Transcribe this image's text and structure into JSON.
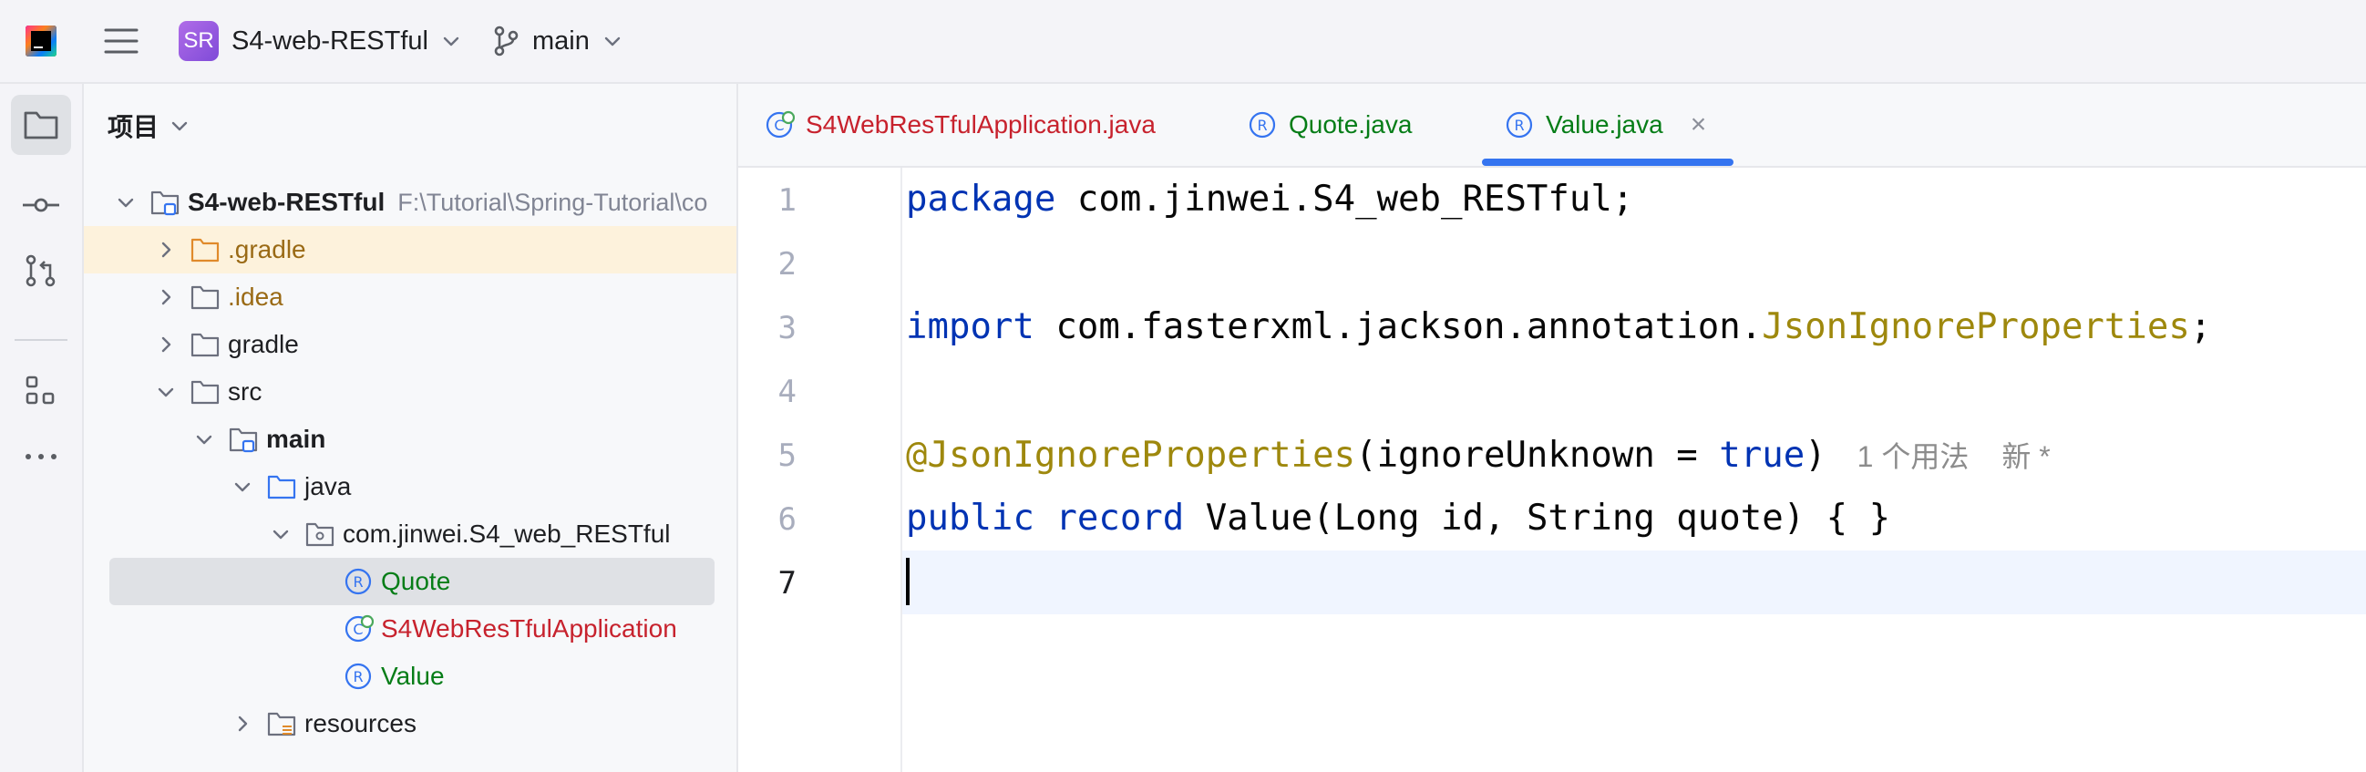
{
  "titlebar": {
    "project_avatar": "SR",
    "project_name": "S4-web-RESTful",
    "branch": "main"
  },
  "toolstrip": {
    "items": [
      "folder-icon",
      "commit-icon",
      "pull-request-icon",
      "structure-icon",
      "more-icon"
    ]
  },
  "project_panel": {
    "title": "项目",
    "tree": [
      {
        "label": "S4-web-RESTful",
        "path": "F:\\Tutorial\\Spring-Tutorial\\co"
      },
      {
        "label": ".gradle"
      },
      {
        "label": ".idea"
      },
      {
        "label": "gradle"
      },
      {
        "label": "src"
      },
      {
        "label": "main"
      },
      {
        "label": "java"
      },
      {
        "label": "com.jinwei.S4_web_RESTful"
      },
      {
        "label": "Quote"
      },
      {
        "label": "S4WebResTfulApplication"
      },
      {
        "label": "Value"
      },
      {
        "label": "resources"
      }
    ]
  },
  "tabs": [
    {
      "label": "S4WebResTfulApplication.java"
    },
    {
      "label": "Quote.java"
    },
    {
      "label": "Value.java",
      "close": "×"
    }
  ],
  "editor": {
    "line_numbers": [
      "1",
      "2",
      "3",
      "4",
      "5",
      "6",
      "7"
    ],
    "line1": {
      "kw": "package",
      "rest": " com.jinwei.S4_web_RESTful;"
    },
    "line3": {
      "kw": "import",
      "rest": " com.fasterxml.jackson.annotation.",
      "ann": "JsonIgnoreProperties",
      "end": ";"
    },
    "line5": {
      "ann": "@JsonIgnoreProperties",
      "mid": "(ignoreUnknown = ",
      "kw": "true",
      "end": ")",
      "hint_usages": "1 个用法",
      "hint_new": "新 *"
    },
    "line6": {
      "kw1": "public",
      "kw2": "record",
      "rest": " Value(Long id, String quote) { }"
    }
  },
  "colors": {
    "accent": "#3574f0",
    "green_file": "#067d17",
    "red_file": "#c7222d",
    "keyword": "#0033b3",
    "annotation": "#9e880d"
  }
}
